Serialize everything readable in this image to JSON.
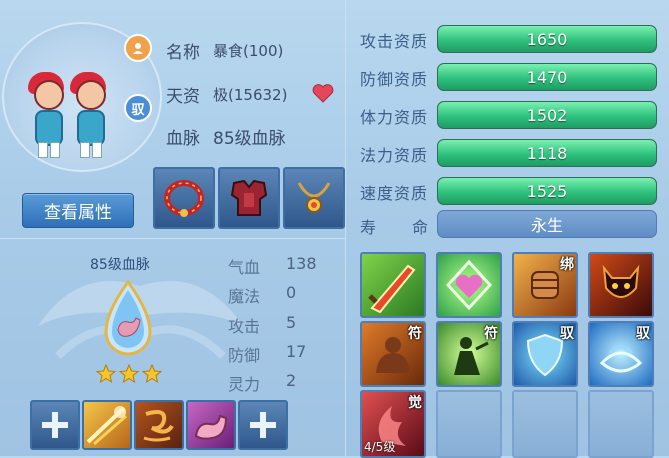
{
  "pet_info": {
    "name_label": "名称",
    "name_value": "暴食(100)",
    "talent_label": "天资",
    "talent_value": "极(15632)",
    "bloodline_label": "血脉",
    "bloodline_value": "85级血脉",
    "mount_badge": "驭"
  },
  "buttons": {
    "view_attributes": "查看属性"
  },
  "equipment": [
    {
      "name": "collar"
    },
    {
      "name": "armor"
    },
    {
      "name": "necklace"
    }
  ],
  "bloodline_panel": {
    "title": "85级血脉",
    "stars": 3
  },
  "pet_stats": [
    {
      "label": "气血",
      "value": "138"
    },
    {
      "label": "魔法",
      "value": "0"
    },
    {
      "label": "攻击",
      "value": "5"
    },
    {
      "label": "防御",
      "value": "17"
    },
    {
      "label": "灵力",
      "value": "2"
    }
  ],
  "aptitudes": [
    {
      "label": "攻击资质",
      "value": "1650",
      "fill": 1.0
    },
    {
      "label": "防御资质",
      "value": "1470",
      "fill": 1.0
    },
    {
      "label": "体力资质",
      "value": "1502",
      "fill": 1.0
    },
    {
      "label": "法力资质",
      "value": "1118",
      "fill": 1.0
    },
    {
      "label": "速度资质",
      "value": "1525",
      "fill": 1.0
    }
  ],
  "lifespan": {
    "label_1": "寿",
    "label_2": "命",
    "value": "永生"
  },
  "skills": [
    {
      "tag": "",
      "lvl": ""
    },
    {
      "tag": "",
      "lvl": ""
    },
    {
      "tag": "绑",
      "lvl": ""
    },
    {
      "tag": "",
      "lvl": ""
    },
    {
      "tag": "符",
      "lvl": ""
    },
    {
      "tag": "符",
      "lvl": ""
    },
    {
      "tag": "驭",
      "lvl": ""
    },
    {
      "tag": "驭",
      "lvl": ""
    },
    {
      "tag": "觉",
      "lvl": "4/5级"
    }
  ],
  "colors": {
    "bar_fill": "#2fc17e",
    "panel_bg": "#a8cbe8",
    "accent_blue": "#2e6fb8"
  }
}
